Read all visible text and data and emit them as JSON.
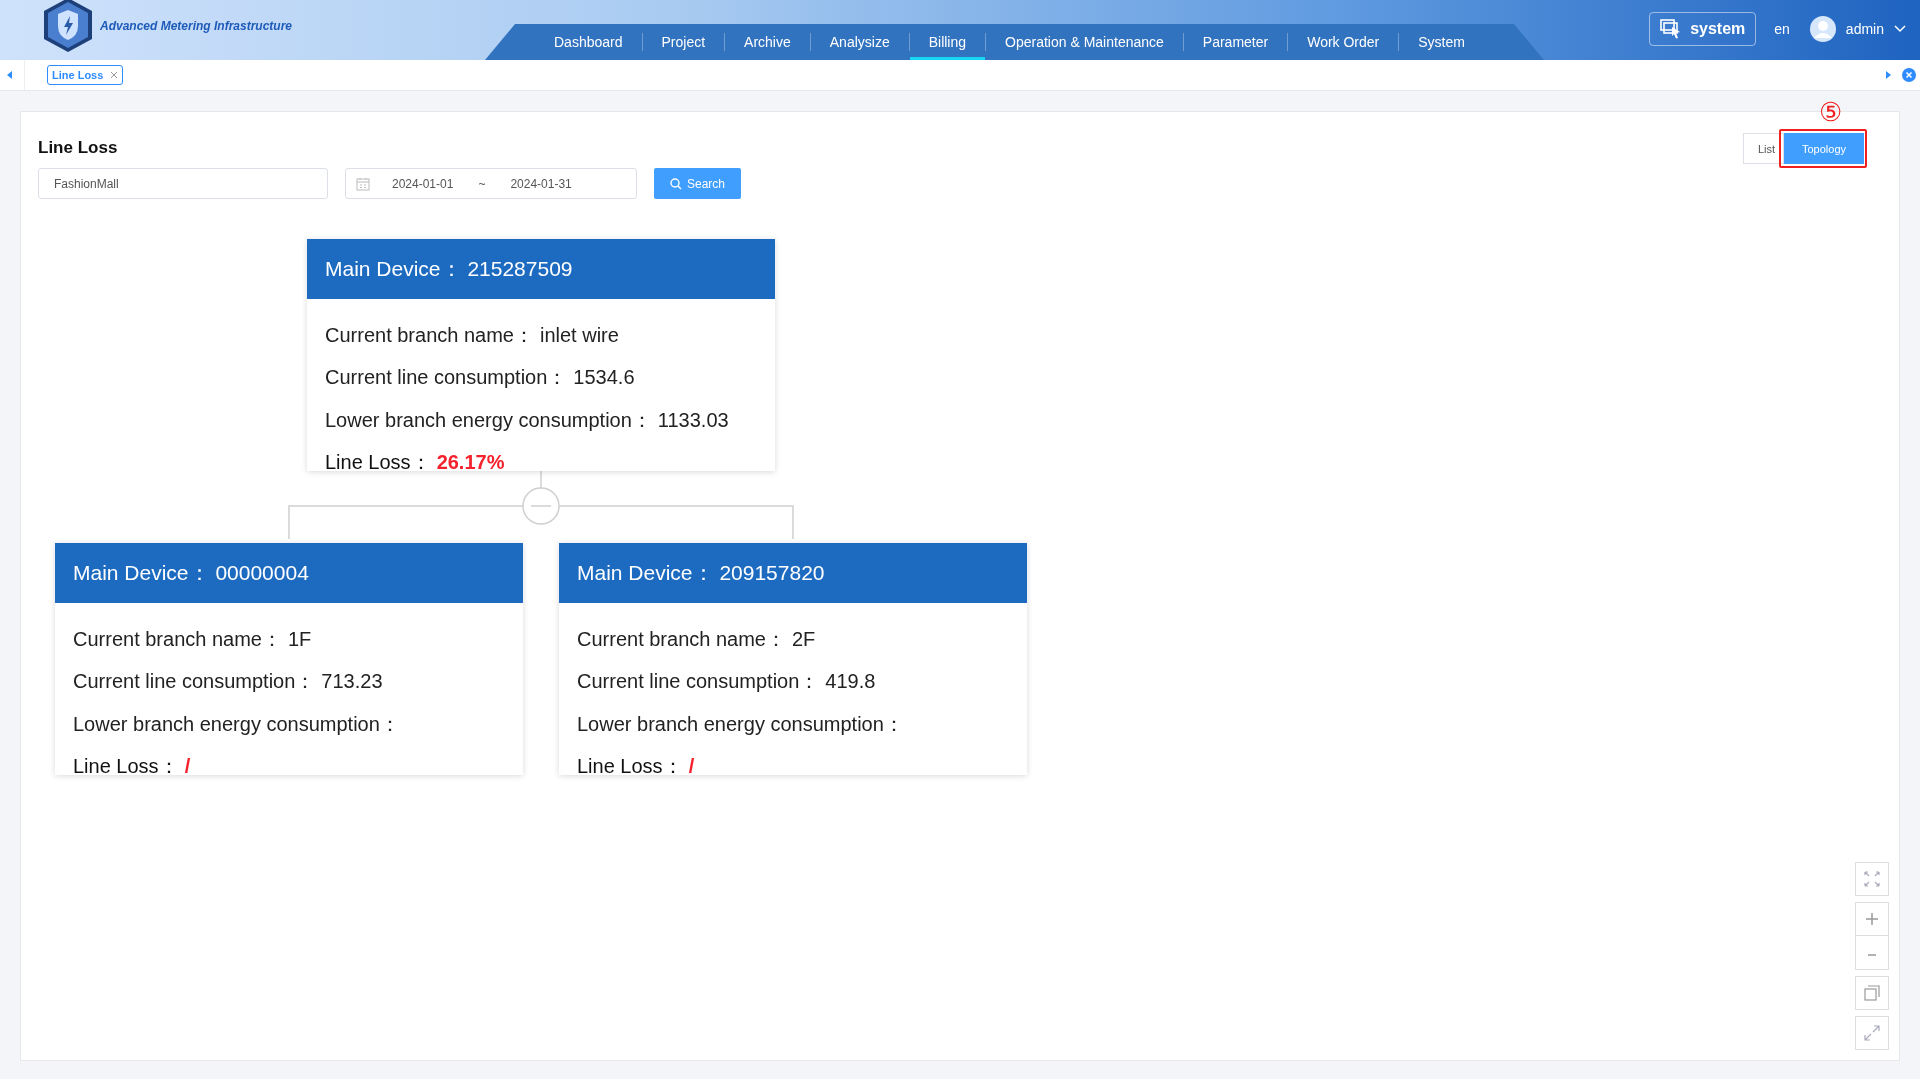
{
  "header": {
    "app_name": "Advanced Metering Infrastructure",
    "nav": [
      {
        "label": "Dashboard",
        "selected": false
      },
      {
        "label": "Project",
        "selected": false
      },
      {
        "label": "Archive",
        "selected": false
      },
      {
        "label": "Analysize",
        "selected": false
      },
      {
        "label": "Billing",
        "selected": true
      },
      {
        "label": "Operation & Maintenance",
        "selected": false
      },
      {
        "label": "Parameter",
        "selected": false
      },
      {
        "label": "Work Order",
        "selected": false
      },
      {
        "label": "System",
        "selected": false
      }
    ],
    "system_button": "system",
    "language": "en",
    "user": "admin"
  },
  "tabs": [
    {
      "label": "Line Loss",
      "selected": true
    }
  ],
  "page": {
    "title": "Line Loss",
    "project_field": {
      "value": "FashionMall"
    },
    "date_range": {
      "start": "2024-01-01",
      "separator": "~",
      "end": "2024-01-31"
    },
    "search_button": "Search",
    "view_toggle": [
      {
        "label": "List",
        "selected": false
      },
      {
        "label": "Topology",
        "selected": true
      }
    ],
    "annotation": "⑤"
  },
  "topology": {
    "root": {
      "title": "Main Device：",
      "device": "215287509",
      "expanded": true,
      "fields": [
        {
          "kind": "text",
          "label": "Current branch name：",
          "value": "inlet wire"
        },
        {
          "kind": "text",
          "label": "Current line consumption：",
          "value": "1534.6"
        },
        {
          "kind": "text",
          "label": "Lower branch energy consumption：",
          "value": "1133.03"
        },
        {
          "kind": "loss",
          "label": "Line Loss：",
          "value": "26.17%"
        }
      ],
      "children": [
        {
          "title": "Main Device：",
          "device": "00000004",
          "fields": [
            {
              "kind": "text",
              "label": "Current branch name：",
              "value": "1F"
            },
            {
              "kind": "text",
              "label": "Current line consumption：",
              "value": "713.23"
            },
            {
              "kind": "text",
              "label": "Lower branch energy consumption："
            },
            {
              "kind": "loss",
              "label": "Line Loss：",
              "value": "/"
            }
          ]
        },
        {
          "title": "Main Device：",
          "device": "209157820",
          "fields": [
            {
              "kind": "text",
              "label": "Current branch name：",
              "value": "2F"
            },
            {
              "kind": "text",
              "label": "Current line consumption：",
              "value": "419.8"
            },
            {
              "kind": "text",
              "label": "Lower branch energy consumption："
            },
            {
              "kind": "loss",
              "label": "Line Loss：",
              "value": "/"
            }
          ]
        }
      ]
    }
  }
}
